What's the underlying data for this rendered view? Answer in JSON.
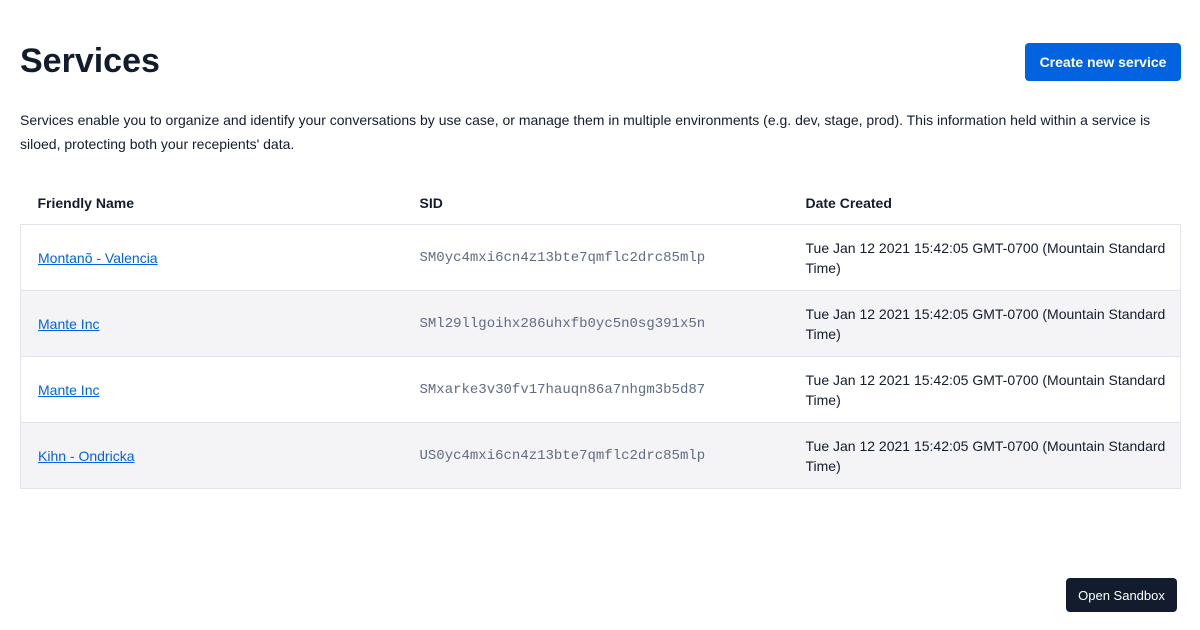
{
  "header": {
    "title": "Services",
    "create_button_label": "Create new service"
  },
  "description": "Services enable you to organize and identify your conversations by use case, or manage them in multiple environments (e.g. dev, stage, prod). This information held within a service is siloed, protecting both your recepients' data.",
  "table": {
    "columns": [
      "Friendly Name",
      "SID",
      "Date Created"
    ],
    "rows": [
      {
        "name": "Montanõ - Valencia",
        "sid": "SM0yc4mxi6cn4z13bte7qmflc2drc85mlp",
        "date": "Tue Jan 12 2021 15:42:05 GMT-0700 (Mountain Standard Time)"
      },
      {
        "name": "Mante Inc",
        "sid": "SMl29llgoihx286uhxfb0yc5n0sg391x5n",
        "date": "Tue Jan 12 2021 15:42:05 GMT-0700 (Mountain Standard Time)"
      },
      {
        "name": "Mante Inc",
        "sid": "SMxarke3v30fv17hauqn86a7nhgm3b5d87",
        "date": "Tue Jan 12 2021 15:42:05 GMT-0700 (Mountain Standard Time)"
      },
      {
        "name": "Kihn - Ondricka",
        "sid": "US0yc4mxi6cn4z13bte7qmflc2drc85mlp",
        "date": "Tue Jan 12 2021 15:42:05 GMT-0700 (Mountain Standard Time)"
      }
    ]
  },
  "sandbox": {
    "button_label": "Open Sandbox"
  },
  "colors": {
    "accent": "#0263e0",
    "text": "#121c2d",
    "row_alt": "#f4f4f6",
    "sandbox_bg": "#121c2d"
  }
}
